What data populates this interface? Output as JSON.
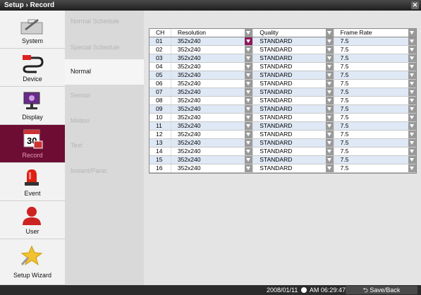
{
  "window": {
    "title": "Setup › Record"
  },
  "sidebar": {
    "items": [
      {
        "label": "System",
        "icon": "wrench-icon"
      },
      {
        "label": "Device",
        "icon": "cable-icon"
      },
      {
        "label": "Display",
        "icon": "monitor-icon"
      },
      {
        "label": "Record",
        "icon": "calendar-icon",
        "badge": "30"
      },
      {
        "label": "Event",
        "icon": "siren-icon"
      },
      {
        "label": "User",
        "icon": "user-icon"
      },
      {
        "label": "Setup Wizard",
        "icon": "star-icon"
      }
    ],
    "active": "Record"
  },
  "subnav": {
    "items": [
      "Normal Schedule",
      "Special Schedule",
      "Normal",
      "Sensor",
      "Motion",
      "Text",
      "Instant/Panic"
    ],
    "active": "Normal"
  },
  "table": {
    "headers": [
      "CH",
      "Resolution",
      "Quality",
      "Frame Rate"
    ],
    "rows": [
      {
        "ch": "01",
        "resolution": "352x240",
        "quality": "STANDARD",
        "frame_rate": "7.5"
      },
      {
        "ch": "02",
        "resolution": "352x240",
        "quality": "STANDARD",
        "frame_rate": "7.5"
      },
      {
        "ch": "03",
        "resolution": "352x240",
        "quality": "STANDARD",
        "frame_rate": "7.5"
      },
      {
        "ch": "04",
        "resolution": "352x240",
        "quality": "STANDARD",
        "frame_rate": "7.5"
      },
      {
        "ch": "05",
        "resolution": "352x240",
        "quality": "STANDARD",
        "frame_rate": "7.5"
      },
      {
        "ch": "06",
        "resolution": "352x240",
        "quality": "STANDARD",
        "frame_rate": "7.5"
      },
      {
        "ch": "07",
        "resolution": "352x240",
        "quality": "STANDARD",
        "frame_rate": "7.5"
      },
      {
        "ch": "08",
        "resolution": "352x240",
        "quality": "STANDARD",
        "frame_rate": "7.5"
      },
      {
        "ch": "09",
        "resolution": "352x240",
        "quality": "STANDARD",
        "frame_rate": "7.5"
      },
      {
        "ch": "10",
        "resolution": "352x240",
        "quality": "STANDARD",
        "frame_rate": "7.5"
      },
      {
        "ch": "11",
        "resolution": "352x240",
        "quality": "STANDARD",
        "frame_rate": "7.5"
      },
      {
        "ch": "12",
        "resolution": "352x240",
        "quality": "STANDARD",
        "frame_rate": "7.5"
      },
      {
        "ch": "13",
        "resolution": "352x240",
        "quality": "STANDARD",
        "frame_rate": "7.5"
      },
      {
        "ch": "14",
        "resolution": "352x240",
        "quality": "STANDARD",
        "frame_rate": "7.5"
      },
      {
        "ch": "15",
        "resolution": "352x240",
        "quality": "STANDARD",
        "frame_rate": "7.5"
      },
      {
        "ch": "16",
        "resolution": "352x240",
        "quality": "STANDARD",
        "frame_rate": "7.5"
      }
    ]
  },
  "footer": {
    "date": "2008/01/11",
    "time": "AM 06:29:47",
    "save_label": "Save/Back"
  },
  "colors": {
    "accent": "#6e0d34",
    "row_alt": "#dfe8f5",
    "dropdown_selected": "#8b1a5a"
  }
}
